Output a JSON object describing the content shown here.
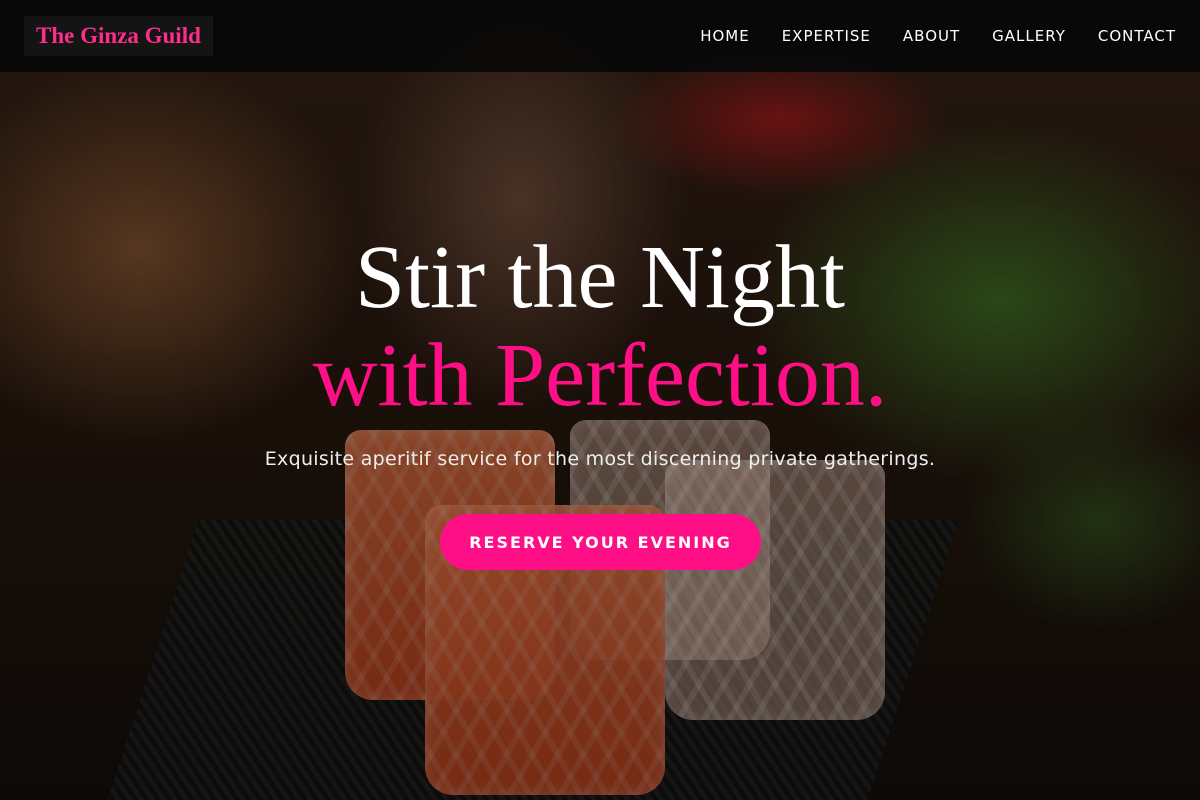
{
  "brand": {
    "name": "The Ginza Guild",
    "accent_color": "#ff0f86"
  },
  "nav": {
    "items": [
      "HOME",
      "EXPERTISE",
      "ABOUT",
      "GALLERY",
      "CONTACT"
    ]
  },
  "hero": {
    "headline_line1": "Stir the Night",
    "headline_line2": "with Perfection.",
    "subtitle": "Exquisite aperitif service for the most discerning private gatherings.",
    "cta_label": "RESERVE YOUR EVENING"
  }
}
